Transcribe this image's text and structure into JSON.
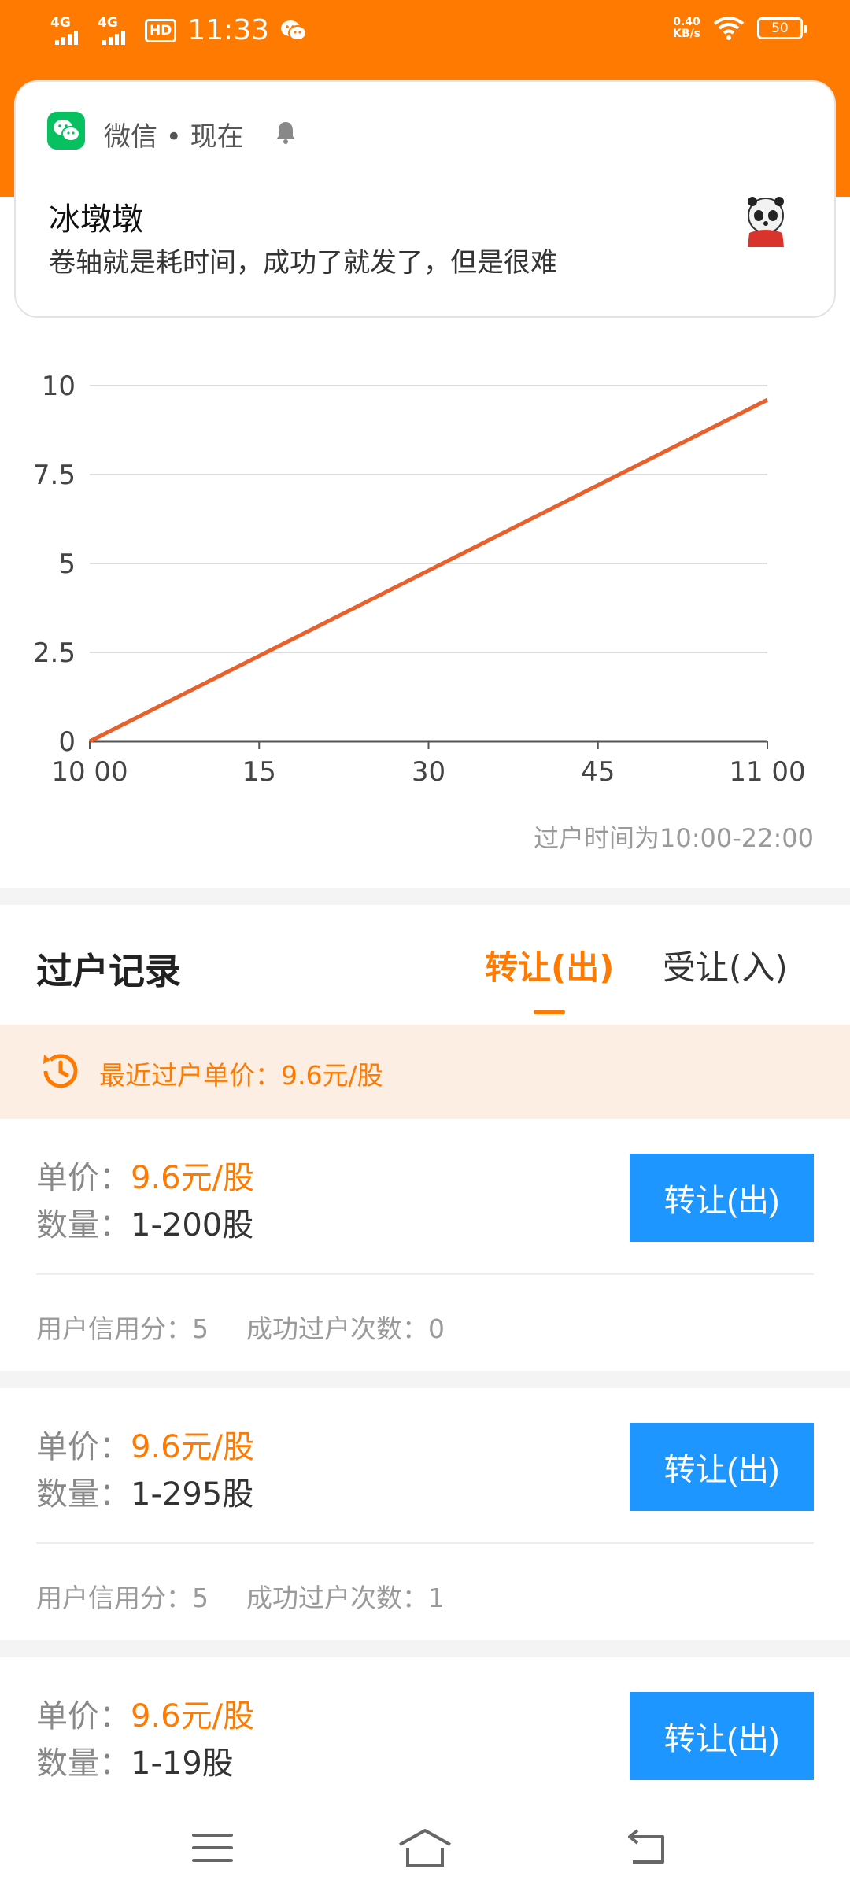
{
  "status_bar": {
    "signal1": "4G",
    "signal2": "4G",
    "hd_label": "HD",
    "time": "11:33",
    "net_speed_value": "0.40",
    "net_speed_unit": "KB/s",
    "battery": "50"
  },
  "notification": {
    "app_name": "微信 • 现在",
    "sender": "冰墩墩",
    "message": "卷轴就是耗时间，成功了就发了，但是很难"
  },
  "chart_data": {
    "type": "line",
    "x_tick_labels": [
      "10 00",
      "15",
      "30",
      "45",
      "11 00"
    ],
    "x_tick_minutes": [
      0,
      15,
      30,
      45,
      60
    ],
    "y_tick_labels": [
      "0",
      "2.5",
      "5",
      "7.5",
      "10"
    ],
    "ylim": [
      0,
      10
    ],
    "xlim_minutes": [
      0,
      60
    ],
    "series": [
      {
        "x_minutes": [
          0,
          60
        ],
        "values": [
          0,
          9.6
        ],
        "color": "#e8602c"
      }
    ],
    "grid": true,
    "note": "过户时间为10:00-22:00"
  },
  "records": {
    "title": "过户记录",
    "tabs": [
      {
        "label": "转让(出)",
        "active": true
      },
      {
        "label": "受让(入)",
        "active": false
      }
    ],
    "recent_price": "最近过户单价：9.6元/股",
    "items": [
      {
        "price_label": "单价：",
        "price": "9.6元/股",
        "qty_label": "数量：",
        "qty": "1-200股",
        "button": "转让(出)",
        "credit": "用户信用分：5",
        "count": "成功过户次数：0"
      },
      {
        "price_label": "单价：",
        "price": "9.6元/股",
        "qty_label": "数量：",
        "qty": "1-295股",
        "button": "转让(出)",
        "credit": "用户信用分：5",
        "count": "成功过户次数：1"
      },
      {
        "price_label": "单价：",
        "price": "9.6元/股",
        "qty_label": "数量：",
        "qty": "1-19股",
        "button": "转让(出)"
      }
    ]
  },
  "colors": {
    "header": "#ff7a00",
    "accent": "#ff7a00",
    "button": "#1e96ff",
    "line": "#e8602c"
  },
  "icons": [
    "wechat-icon",
    "bell-icon",
    "clock-refresh-icon",
    "menu-icon",
    "home-icon",
    "back-icon"
  ]
}
